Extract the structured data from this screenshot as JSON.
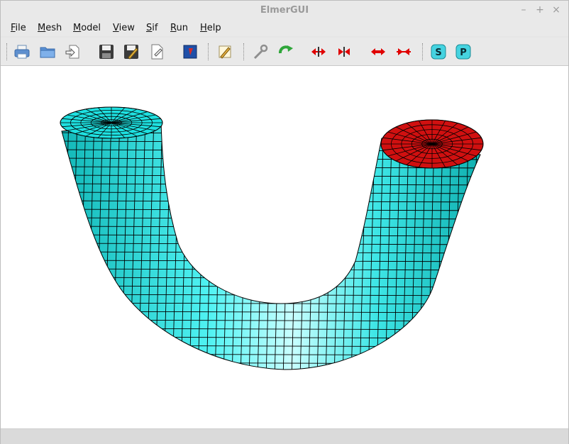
{
  "window": {
    "title": "ElmerGUI"
  },
  "window_controls": {
    "minimize": "–",
    "maximize": "+",
    "close": "×"
  },
  "menu": {
    "items": [
      {
        "label": "File",
        "mnemonic": "F"
      },
      {
        "label": "Mesh",
        "mnemonic": "M"
      },
      {
        "label": "Model",
        "mnemonic": "M"
      },
      {
        "label": "View",
        "mnemonic": "V"
      },
      {
        "label": "Sif",
        "mnemonic": "S"
      },
      {
        "label": "Run",
        "mnemonic": "R"
      },
      {
        "label": "Help",
        "mnemonic": "H"
      }
    ]
  },
  "toolbar": {
    "buttons": [
      {
        "name": "print-icon"
      },
      {
        "name": "open-folder-icon"
      },
      {
        "name": "import-icon"
      },
      {
        "name": "save-icon"
      },
      {
        "name": "save-as-icon"
      },
      {
        "name": "new-document-icon"
      },
      {
        "name": "image-icon"
      },
      {
        "name": "edit-icon"
      },
      {
        "name": "wrench-icon"
      },
      {
        "name": "refresh-icon"
      },
      {
        "name": "divide-surface-icon"
      },
      {
        "name": "unify-surface-icon"
      },
      {
        "name": "divide-edge-icon"
      },
      {
        "name": "unify-edge-icon"
      },
      {
        "name": "s-button-icon",
        "label": "S"
      },
      {
        "name": "p-button-icon",
        "label": "P"
      }
    ]
  },
  "mesh": {
    "body_color": "#1ee0e0",
    "selected_face_color": "#d01010",
    "edge_color": "#000000"
  }
}
